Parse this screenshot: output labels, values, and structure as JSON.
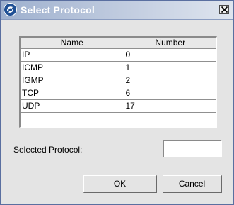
{
  "window": {
    "title": "Select Protocol",
    "icon": "app-logo-icon",
    "close_icon": "close-icon"
  },
  "table": {
    "columns": [
      "Name",
      "Number"
    ],
    "rows": [
      [
        "IP",
        "0"
      ],
      [
        "ICMP",
        "1"
      ],
      [
        "IGMP",
        "2"
      ],
      [
        "TCP",
        "6"
      ],
      [
        "UDP",
        "17"
      ]
    ]
  },
  "selected": {
    "label": "Selected Protocol:",
    "value": ""
  },
  "buttons": {
    "ok": "OK",
    "cancel": "Cancel"
  },
  "colors": {
    "titlebar_start": "#9eb0ce",
    "titlebar_end": "#dfe5ef",
    "dialog_bg": "#e4e4e4"
  }
}
